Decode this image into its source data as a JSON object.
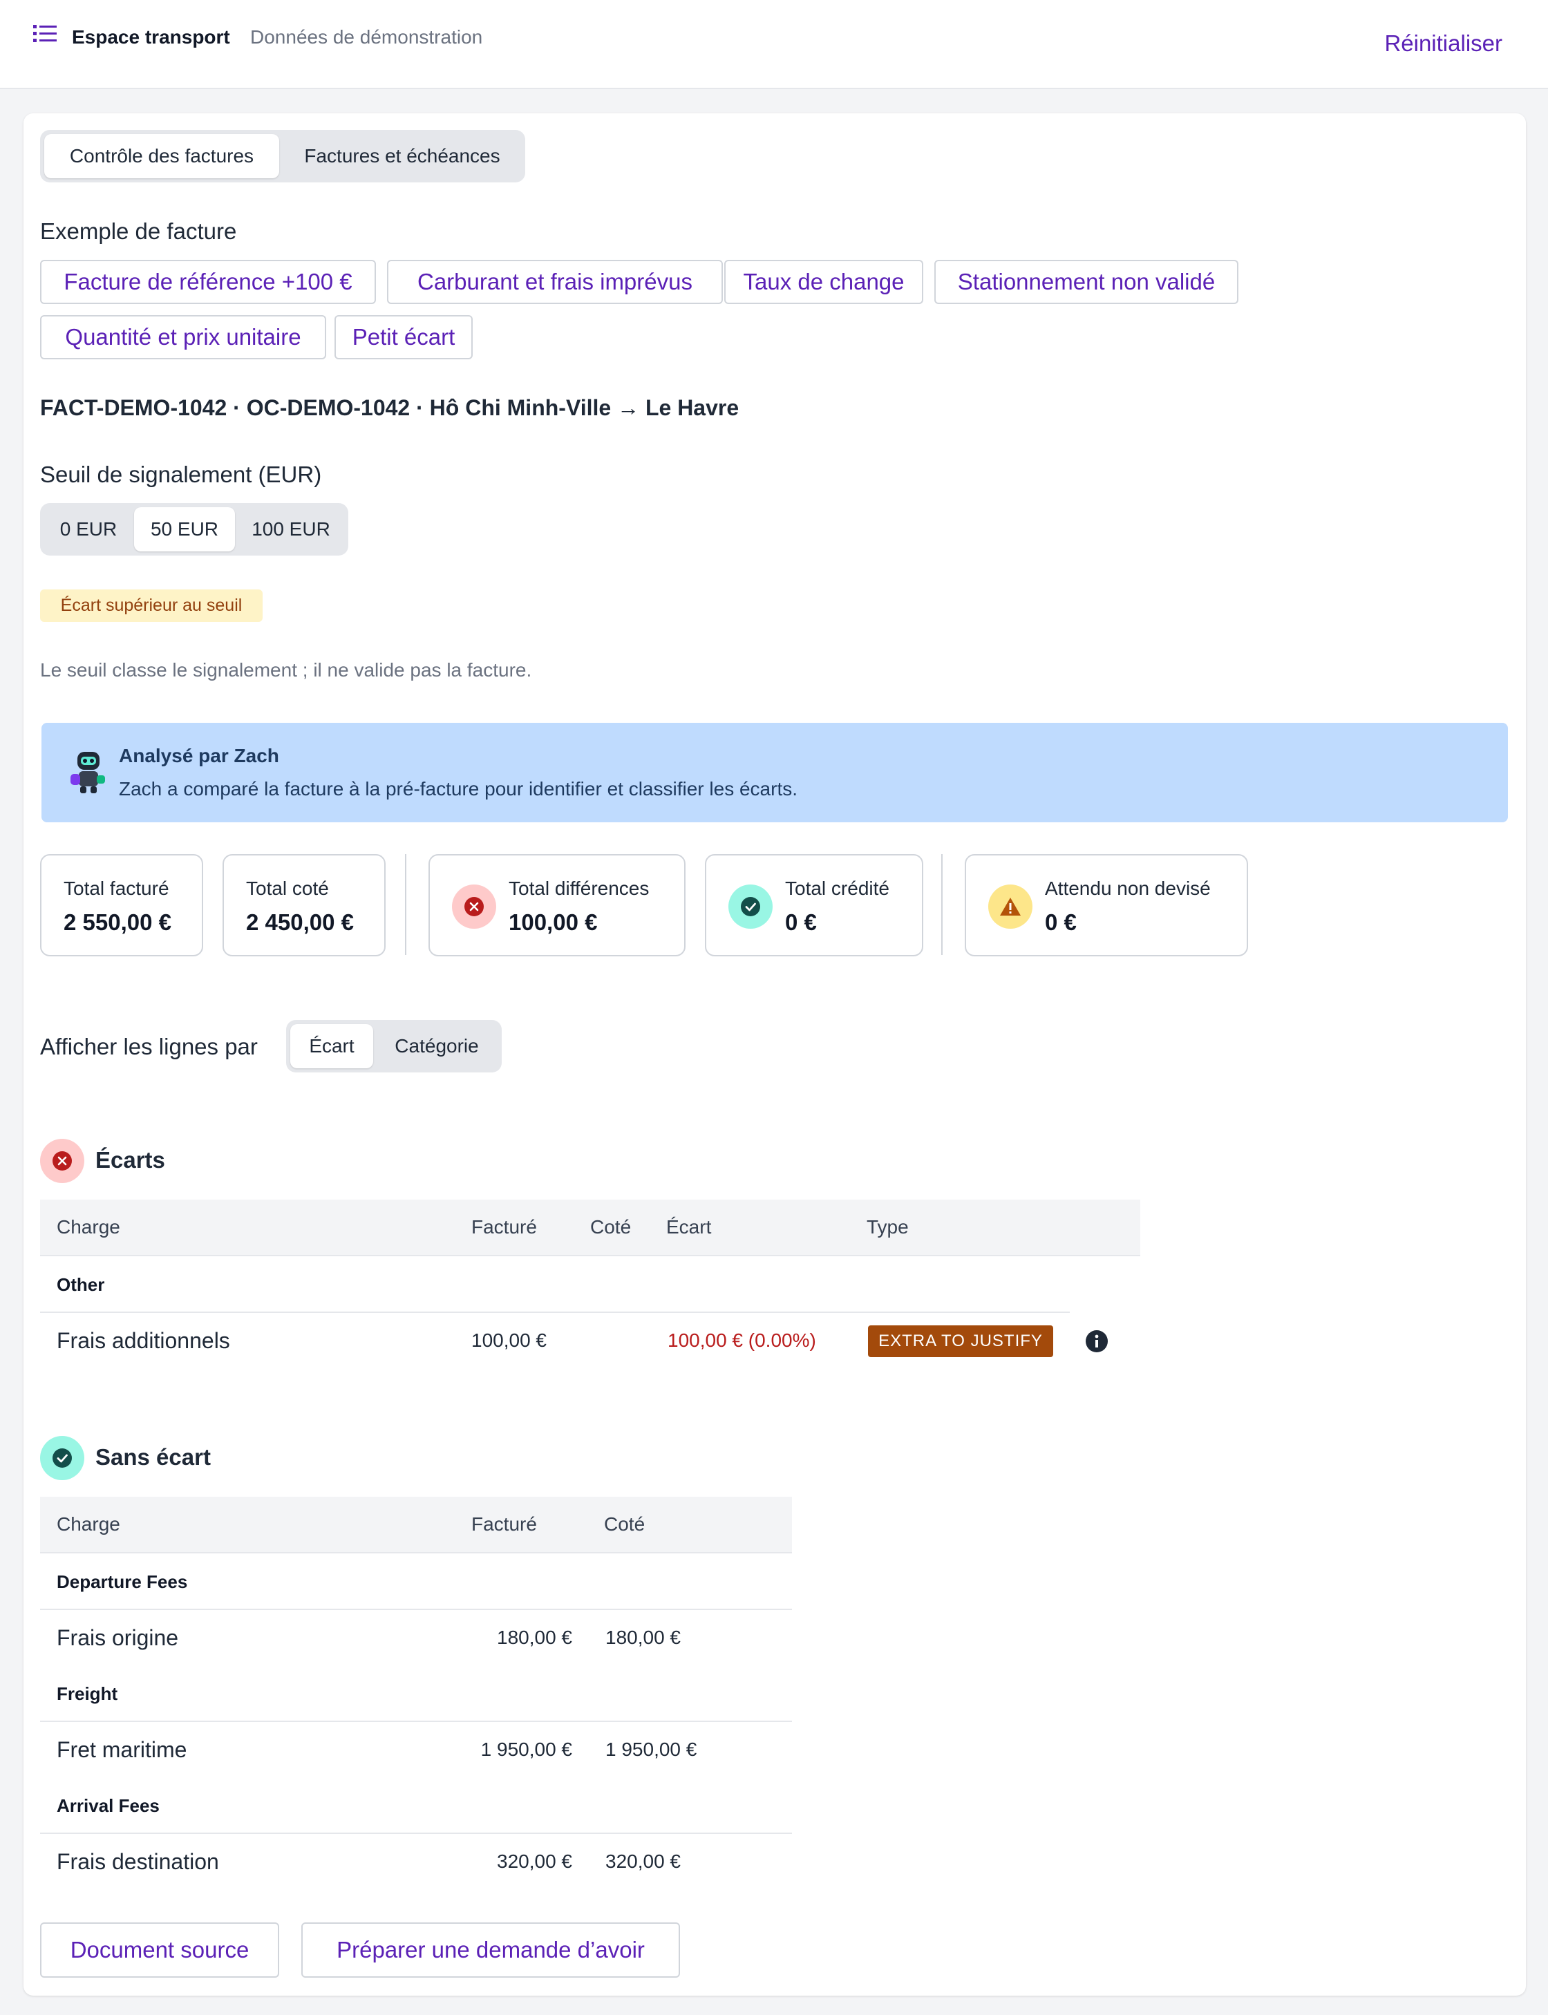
{
  "header": {
    "title": "Espace transport",
    "subtitle": "Données de démonstration",
    "reset_label": "Réinitialiser"
  },
  "tabs": [
    {
      "label": "Contrôle des factures"
    },
    {
      "label": "Factures et échéances"
    }
  ],
  "examples": {
    "label": "Exemple de facture",
    "chips": [
      "Facture de référence +100 €",
      "Carburant et frais imprévus",
      "Taux de change",
      "Stationnement non validé",
      "Quantité et prix unitaire",
      "Petit écart"
    ]
  },
  "invoice_id": "FACT-DEMO-1042 · OC-DEMO-1042 · Hô Chi Minh-Ville → Le Havre",
  "threshold": {
    "label": "Seuil de signalement (EUR)",
    "options": [
      "0 EUR",
      "50 EUR",
      "100 EUR"
    ],
    "badge": "Écart supérieur au seuil",
    "note": "Le seuil classe le signalement ; il ne valide pas la facture."
  },
  "zach": {
    "title": "Analysé par Zach",
    "text": "Zach a comparé la facture à la pré-facture pour identifier et classifier les écarts."
  },
  "stats": [
    {
      "label": "Total facturé",
      "value": "2 550,00 €"
    },
    {
      "label": "Total coté",
      "value": "2 450,00 €"
    },
    {
      "label": "Total différences",
      "value": "100,00 €"
    },
    {
      "label": "Total crédité",
      "value": "0 €"
    },
    {
      "label": "Attendu non devisé",
      "value": "0 €"
    }
  ],
  "view_by": {
    "label": "Afficher les lignes par",
    "options": [
      "Écart",
      "Catégorie"
    ]
  },
  "ecarts": {
    "title": "Écarts",
    "headers": [
      "Charge",
      "Facturé",
      "Coté",
      "Écart",
      "Type"
    ],
    "group": "Other",
    "row": {
      "charge": "Frais additionnels",
      "billed": "100,00 €",
      "quoted": "",
      "diff": "100,00 € (0.00%)",
      "type": "EXTRA TO JUSTIFY"
    }
  },
  "sans_ecart": {
    "title": "Sans écart",
    "headers": [
      "Charge",
      "Facturé",
      "Coté"
    ],
    "groups": [
      {
        "name": "Departure Fees",
        "charge": "Frais origine",
        "billed": "180,00 €",
        "quoted": "180,00 €"
      },
      {
        "name": "Freight",
        "charge": "Fret maritime",
        "billed": "1 950,00 €",
        "quoted": "1 950,00 €"
      },
      {
        "name": "Arrival Fees",
        "charge": "Frais destination",
        "billed": "320,00 €",
        "quoted": "320,00 €"
      }
    ]
  },
  "actions": {
    "source": "Document source",
    "credit": "Préparer une demande d’avoir"
  },
  "colors": {
    "accent": "#5b21b6",
    "danger": "#b91c1c",
    "success": "#0f766e",
    "warning": "#b45309",
    "info_bg": "#bfdbfe"
  }
}
